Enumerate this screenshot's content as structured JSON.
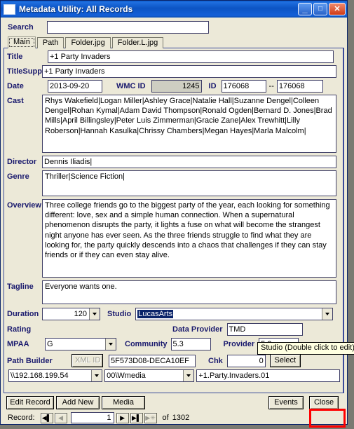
{
  "window": {
    "title": "Metadata Utility: All Records",
    "minimize_label": "_",
    "maximize_label": "□",
    "close_label": "✕"
  },
  "search": {
    "label": "Search",
    "value": "",
    "placeholder": ""
  },
  "tabs": [
    {
      "label": "Main",
      "active": true
    },
    {
      "label": "Path",
      "active": false
    },
    {
      "label": "Folder.jpg",
      "active": false
    },
    {
      "label": "Folder.L.jpg",
      "active": false
    }
  ],
  "fields": {
    "title": {
      "label": "Title",
      "value": "+1 Party Invaders"
    },
    "titlesupp": {
      "label": "TitleSupp",
      "value": "+1 Party Invaders"
    },
    "date": {
      "label": "Date",
      "value": "2013-09-20"
    },
    "wmcid": {
      "label": "WMC ID",
      "value": "1245"
    },
    "id": {
      "label": "ID",
      "value": "176068"
    },
    "id_sep": "--",
    "id2": {
      "value": "176068"
    },
    "cast": {
      "label": "Cast",
      "value": "Rhys Wakefield|Logan Miller|Ashley Grace|Natalie Hall|Suzanne Dengel|Colleen Dengel|Rohan Kymal|Adam David Thompson|Ronald Ogden|Bernard D. Jones|Brad Mills|April Billingsley|Peter Luis Zimmerman|Gracie Zane|Alex Trewhitt|Lilly Roberson|Hannah Kasulka|Chrissy Chambers|Megan Hayes|Marla Malcolm|"
    },
    "director": {
      "label": "Director",
      "value": "Dennis Iliadis|"
    },
    "genre": {
      "label": "Genre",
      "value": "Thriller|Science Fiction|"
    },
    "overview": {
      "label": "Overview",
      "value": "Three college friends go to the biggest party of the year, each looking for something different: love, sex and a simple human connection. When a supernatural phenomenon disrupts the party, it lights a fuse on what will become the strangest night anyone has ever seen. As the three friends struggle to find what they are looking for, the party quickly descends into a chaos that challenges if they can stay friends or if they can even stay alive."
    },
    "tagline": {
      "label": "Tagline",
      "value": "Everyone wants one."
    },
    "duration": {
      "label": "Duration",
      "value": "120"
    },
    "studio": {
      "label": "Studio",
      "value": "LucasArts"
    },
    "rating": {
      "label": "Rating"
    },
    "data_provider": {
      "label": "Data Provider",
      "value": "TMD"
    },
    "mpaa": {
      "label": "MPAA",
      "value": "G"
    },
    "community": {
      "label": "Community",
      "value": "5.3"
    },
    "provider": {
      "label": "Provider",
      "value": "5.3"
    },
    "path_builder": {
      "label": "Path Builder"
    },
    "xml_id": {
      "label": "XML ID",
      "disabled": true
    },
    "guid": {
      "value": "5F573D08-DECA10EF"
    },
    "chk": {
      "label": "Chk",
      "value": "0"
    },
    "select_button": {
      "label": "Select"
    },
    "server": {
      "value": "\\\\192.168.199.54"
    },
    "share": {
      "value": "00\\Wmedia"
    },
    "filename": {
      "value": "+1.Party.Invaders.01"
    }
  },
  "tooltip": {
    "text": "Studio (Double click to edit)"
  },
  "buttons": {
    "edit_record": "Edit Record",
    "add_new": "Add New",
    "media": "Media",
    "events": "Events",
    "close": "Close"
  },
  "navigator": {
    "label": "Record:",
    "first": "◀▌",
    "prev": "◀",
    "current": "1",
    "next": "▶",
    "last": "▶▌",
    "new": "▶✳",
    "of_label": "of",
    "total": "1302"
  },
  "colors": {
    "titlebar_blue": "#0c54c4",
    "label_navy": "#1a1a6e",
    "panel_border": "#3a4a9a",
    "annotation_red": "#ff0000",
    "tooltip_bg": "#ffffe1",
    "selection_navy": "#0a246a",
    "disabled_gray": "#cecec2"
  }
}
